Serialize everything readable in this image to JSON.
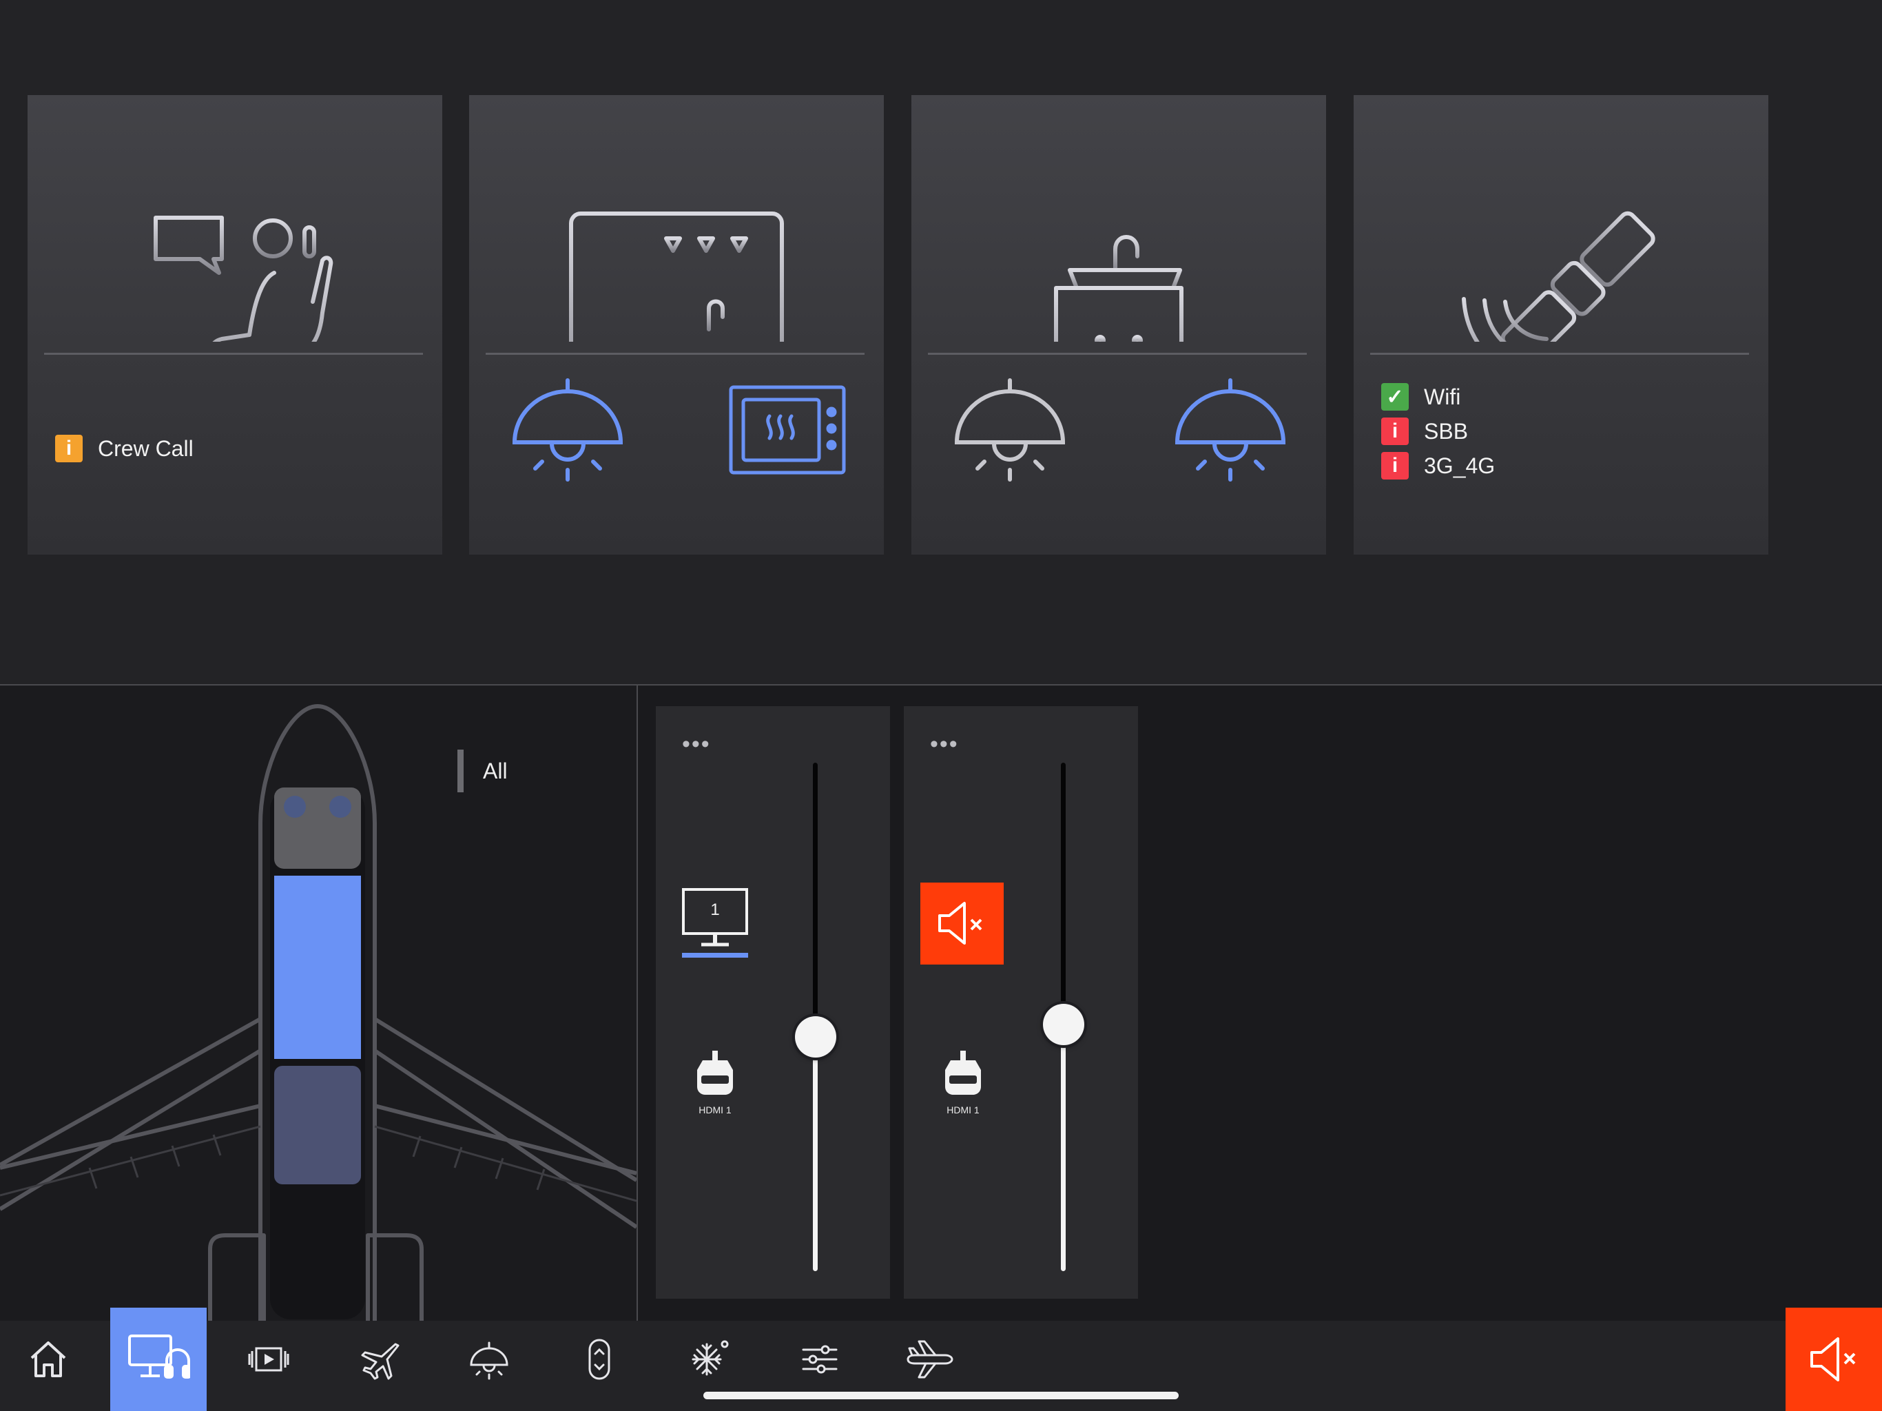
{
  "cards": {
    "crew": {
      "icon": "seat-chat-icon",
      "status": {
        "badge": "i",
        "label": "Crew Call",
        "color": "#f5a22e"
      }
    },
    "galley": {
      "icon": "galley-icon",
      "controls": [
        "pendant-lamp-icon",
        "oven-icon"
      ]
    },
    "lavatory": {
      "icon": "sink-cabinet-icon",
      "controls": [
        "pendant-lamp-icon",
        "pendant-lamp-icon"
      ]
    },
    "connectivity": {
      "icon": "satellite-icon",
      "statuses": [
        {
          "badge": "✓",
          "label": "Wifi",
          "state": "ok",
          "color": "#4aa94a"
        },
        {
          "badge": "i",
          "label": "SBB",
          "state": "error",
          "color": "#f53b49"
        },
        {
          "badge": "i",
          "label": "3G_4G",
          "state": "error",
          "color": "#f53b49"
        }
      ]
    }
  },
  "zones": {
    "all_label": "All"
  },
  "channels": [
    {
      "menu": "•••",
      "display_number": "1",
      "source_label": "HDMI 1",
      "volume": 0.53,
      "muted": false
    },
    {
      "menu": "•••",
      "source_label": "HDMI 1",
      "volume": 0.5,
      "muted": true
    }
  ],
  "tabs": [
    {
      "icon": "home-icon",
      "active": false
    },
    {
      "icon": "monitor-headphones-icon",
      "active": true
    },
    {
      "icon": "media-player-icon",
      "active": false
    },
    {
      "icon": "flight-map-icon",
      "active": false
    },
    {
      "icon": "lighting-icon",
      "active": false
    },
    {
      "icon": "window-shade-icon",
      "active": false
    },
    {
      "icon": "climate-icon",
      "active": false
    },
    {
      "icon": "settings-sliders-icon",
      "active": false
    },
    {
      "icon": "aircraft-icon",
      "active": false
    }
  ],
  "colors": {
    "accent": "#6a92f5",
    "mute": "#ff3c0a",
    "warning": "#f5a22e",
    "error": "#f53b49",
    "ok": "#4aa94a"
  }
}
